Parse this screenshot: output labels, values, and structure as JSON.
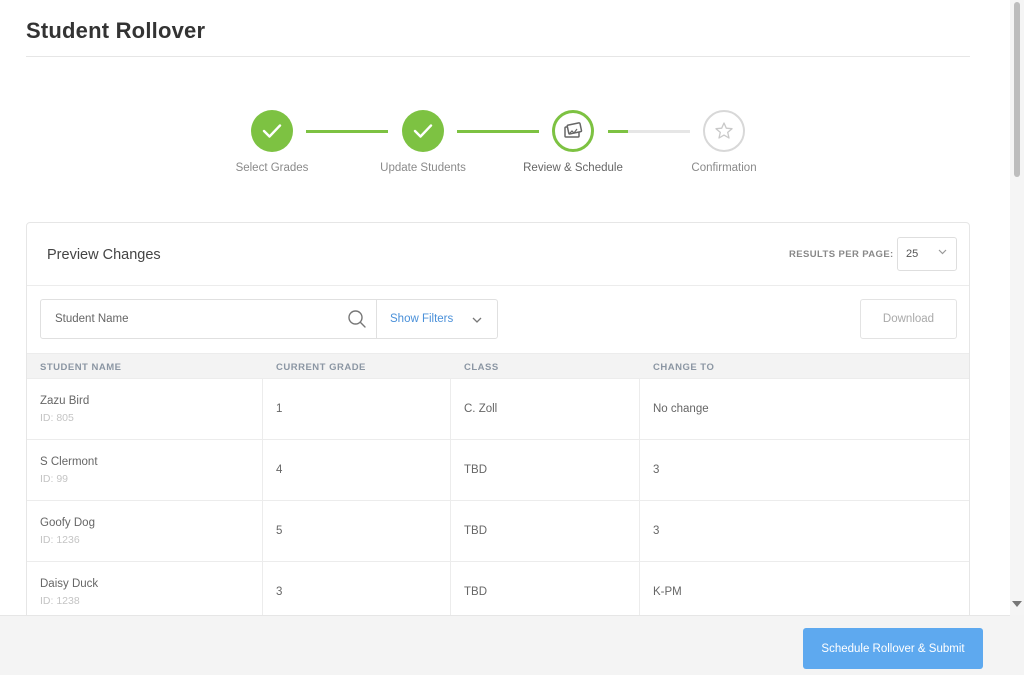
{
  "page": {
    "title": "Student Rollover"
  },
  "stepper": {
    "steps": [
      {
        "label": "Select Grades",
        "state": "done"
      },
      {
        "label": "Update Students",
        "state": "done"
      },
      {
        "label": "Review & Schedule",
        "state": "current"
      },
      {
        "label": "Confirmation",
        "state": "todo"
      }
    ],
    "accent": "#7dc242"
  },
  "preview": {
    "title": "Preview Changes",
    "results_per_page_label": "RESULTS PER PAGE:",
    "results_per_page_value": "25",
    "search_placeholder": "Student Name",
    "show_filters_label": "Show Filters",
    "download_label": "Download"
  },
  "table": {
    "headers": [
      "STUDENT NAME",
      "CURRENT GRADE",
      "CLASS",
      "CHANGE TO"
    ],
    "rows": [
      {
        "name": "Zazu Bird",
        "id": "ID: 805",
        "grade": "1",
        "class": "C. Zoll",
        "change_to": "No change"
      },
      {
        "name": "S Clermont",
        "id": "ID: 99",
        "grade": "4",
        "class": "TBD",
        "change_to": "3"
      },
      {
        "name": "Goofy Dog",
        "id": "ID: 1236",
        "grade": "5",
        "class": "TBD",
        "change_to": "3"
      },
      {
        "name": "Daisy Duck",
        "id": "ID: 1238",
        "grade": "3",
        "class": "TBD",
        "change_to": "K-PM"
      }
    ]
  },
  "footer": {
    "submit_label": "Schedule Rollover & Submit",
    "submit_color": "#5ea9ef"
  },
  "icons": [
    "check-icon",
    "presentation-icon",
    "star-icon",
    "search-icon",
    "chevron-down-icon"
  ]
}
